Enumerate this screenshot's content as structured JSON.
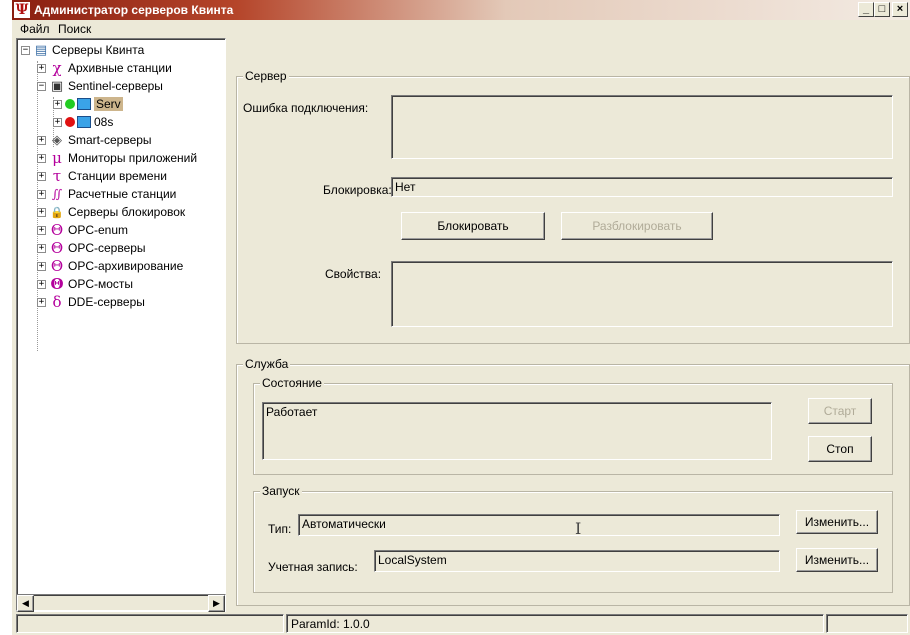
{
  "window": {
    "title": "Администратор серверов Квинта",
    "app_icon": "Ψ",
    "controls": {
      "minimize": "_",
      "maximize": "□",
      "close": "×"
    }
  },
  "menu": [
    "Файл",
    "Поиск"
  ],
  "tree": {
    "root": {
      "label": "Серверы Квинта",
      "icon": "server-rack-icon"
    },
    "items": [
      {
        "label": "Архивные станции",
        "icon": "chi-icon",
        "glyph": "χ"
      },
      {
        "label": "Sentinel-серверы",
        "icon": "sentinel-icon",
        "glyph": "▣"
      },
      {
        "label": "Serv",
        "icon": "pc-icon",
        "status_color": "#22cc22",
        "selected": true
      },
      {
        "label": "08s",
        "icon": "pc-icon",
        "status_color": "#e01010"
      },
      {
        "label": "Smart-серверы",
        "icon": "disk-icon",
        "glyph": "◈"
      },
      {
        "label": "Мониторы приложений",
        "icon": "mu-icon",
        "glyph": "μ"
      },
      {
        "label": "Станции времени",
        "icon": "tau-icon",
        "glyph": "τ"
      },
      {
        "label": "Расчетные станции",
        "icon": "integral-icon",
        "glyph": "∬"
      },
      {
        "label": "Серверы блокировок",
        "icon": "lock-icon",
        "glyph": "🔒"
      },
      {
        "label": "OPC-enum",
        "icon": "theta-icon",
        "glyph": "Θ"
      },
      {
        "label": "OPC-серверы",
        "icon": "theta-icon",
        "glyph": "Θ"
      },
      {
        "label": "OPC-архивирование",
        "icon": "theta-icon",
        "glyph": "Θ"
      },
      {
        "label": "OPC-мосты",
        "icon": "theta-bridge-icon",
        "glyph": "Θ"
      },
      {
        "label": "DDE-серверы",
        "icon": "delta-icon",
        "glyph": "δ"
      }
    ]
  },
  "server": {
    "title": "Сервер",
    "error_label": "Ошибка подключения:",
    "error_value": "",
    "block_label": "Блокировка:",
    "block_value": "Нет",
    "block_button": "Блокировать",
    "unblock_button": "Разблокировать",
    "props_label": "Свойства:",
    "props_value": ""
  },
  "service": {
    "title": "Служба",
    "state_title": "Состояние",
    "state_value": "Работает",
    "start_button": "Старт",
    "stop_button": "Стоп",
    "launch_title": "Запуск",
    "type_label": "Тип:",
    "type_value": "Автоматически",
    "change_button": "Изменить...",
    "account_label": "Учетная запись:",
    "account_value": "LocalSystem"
  },
  "status": {
    "param": "ParamId: 1.0.0"
  },
  "colors": {
    "title_red": "#8a1f11",
    "selection": "#cdb58c",
    "chrome": "#ece9d8"
  }
}
